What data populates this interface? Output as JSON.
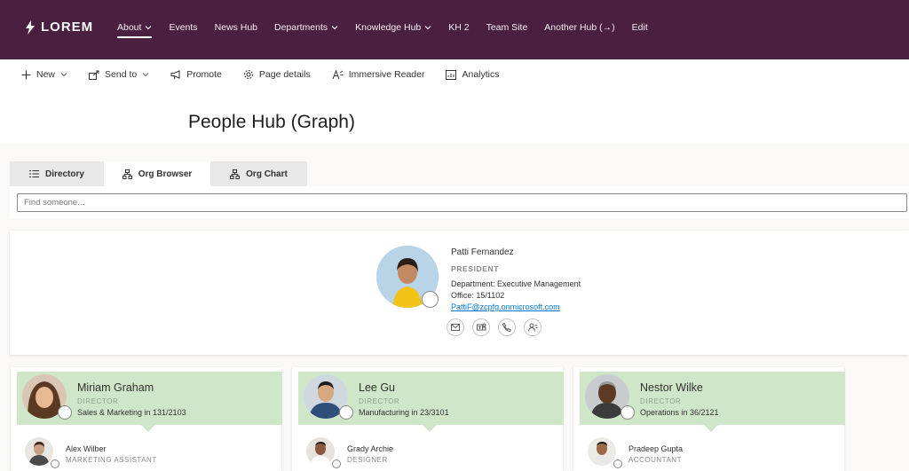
{
  "header": {
    "logo_text": "LOREM",
    "nav": [
      {
        "label": "About",
        "dropdown": true,
        "active": true
      },
      {
        "label": "Events"
      },
      {
        "label": "News Hub"
      },
      {
        "label": "Departments",
        "dropdown": true
      },
      {
        "label": "Knowledge Hub",
        "dropdown": true
      },
      {
        "label": "KH 2"
      },
      {
        "label": "Team Site"
      },
      {
        "label": "Another Hub (→)"
      },
      {
        "label": "Edit"
      }
    ],
    "background": "#4a1f40"
  },
  "commandbar": {
    "new": "New",
    "send_to": "Send to",
    "promote": "Promote",
    "page_details": "Page details",
    "immersive_reader": "Immersive Reader",
    "analytics": "Analytics"
  },
  "page": {
    "title": "People Hub (Graph)"
  },
  "tabs": {
    "directory": "Directory",
    "org_browser": "Org Browser",
    "org_chart": "Org Chart"
  },
  "search": {
    "placeholder": "Find someone..."
  },
  "manager": {
    "name": "Patti Fernandez",
    "role": "PRESIDENT",
    "department": "Department: Executive Management",
    "office": "Office: 15/1102",
    "email": "PattiF@zcpfg.onmicrosoft.com",
    "actions": [
      "mail-icon",
      "teams-icon",
      "phone-icon",
      "contact-card-icon"
    ]
  },
  "directs": [
    {
      "name": "Miriam Graham",
      "role": "DIRECTOR",
      "location": "Sales & Marketing in 131/2103",
      "report": {
        "name": "Alex Wilber",
        "role": "MARKETING ASSISTANT"
      }
    },
    {
      "name": "Lee Gu",
      "role": "DIRECTOR",
      "location": "Manufacturing in 23/3101",
      "report": {
        "name": "Grady Archie",
        "role": "DESIGNER"
      }
    },
    {
      "name": "Nestor Wilke",
      "role": "DIRECTOR",
      "location": "Operations in 36/2121",
      "report": {
        "name": "Pradeep Gupta",
        "role": "ACCOUNTANT"
      }
    }
  ],
  "colors": {
    "director_header": "#cfe6c9",
    "link": "#0078d4"
  }
}
